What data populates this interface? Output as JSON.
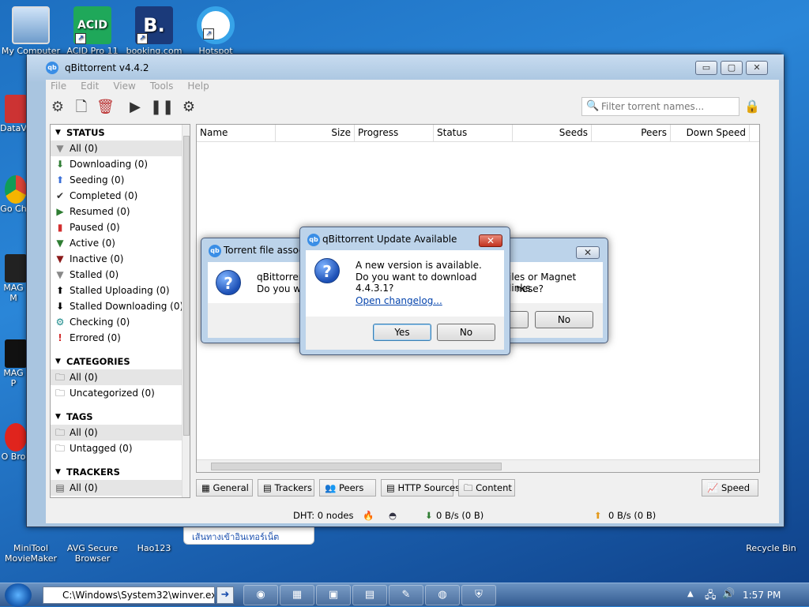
{
  "desktop": {
    "top_icons": [
      {
        "label": "My Computer"
      },
      {
        "label": "ACID Pro 11"
      },
      {
        "label": "booking.com"
      },
      {
        "label": "Hotspot"
      }
    ],
    "left_icons": [
      {
        "label": "DataV"
      },
      {
        "label": "Go Ch"
      },
      {
        "label": "MAG M"
      },
      {
        "label": "MAG P"
      },
      {
        "label": "O Bro"
      }
    ],
    "bottom_icons": [
      {
        "label": "MiniTool MovieMaker"
      },
      {
        "label": "AVG Secure Browser"
      },
      {
        "label": "Hao123"
      },
      {
        "label": "Recycle Bin"
      }
    ],
    "notification_text": "เส้นทางเข้าอินเทอร์เน็ต"
  },
  "window": {
    "title": "qBittorrent v4.4.2",
    "app_icon_text": "qb",
    "controls": {
      "minimize": "▭",
      "maximize": "▢",
      "close": "✕"
    },
    "menu": [
      "File",
      "Edit",
      "View",
      "Tools",
      "Help"
    ],
    "toolbar": {
      "add_link": "add-link-icon",
      "add_file": "add-file-icon",
      "delete": "delete-icon",
      "resume": "resume-icon",
      "pause": "pause-icon",
      "options": "options-icon"
    },
    "filter_placeholder": "Filter torrent names..."
  },
  "sidebar": {
    "status_header": "STATUS",
    "status": [
      {
        "label": "All (0)",
        "icon": "filter-icon",
        "color": "#888888"
      },
      {
        "label": "Downloading (0)",
        "icon": "download-arrow-icon",
        "color": "#2e7d32"
      },
      {
        "label": "Seeding (0)",
        "icon": "upload-arrow-icon",
        "color": "#3a6fd8"
      },
      {
        "label": "Completed (0)",
        "icon": "checkmark-icon",
        "color": "#333333"
      },
      {
        "label": "Resumed (0)",
        "icon": "play-icon",
        "color": "#2e7d32"
      },
      {
        "label": "Paused (0)",
        "icon": "pause-icon",
        "color": "#d32f2f"
      },
      {
        "label": "Active (0)",
        "icon": "filter-icon",
        "color": "#2e7d32"
      },
      {
        "label": "Inactive (0)",
        "icon": "filter-icon",
        "color": "#8b1a1a"
      },
      {
        "label": "Stalled (0)",
        "icon": "filter-icon",
        "color": "#888888"
      },
      {
        "label": "Stalled Uploading (0)",
        "icon": "upload-arrow-icon",
        "color": "#000000"
      },
      {
        "label": "Stalled Downloading (0)",
        "icon": "download-arrow-icon",
        "color": "#000000"
      },
      {
        "label": "Checking (0)",
        "icon": "gear-icon",
        "color": "#1a8a8a"
      },
      {
        "label": "Errored (0)",
        "icon": "exclamation-icon",
        "color": "#d32f2f"
      }
    ],
    "categories_header": "CATEGORIES",
    "categories": [
      "All (0)",
      "Uncategorized (0)"
    ],
    "tags_header": "TAGS",
    "tags": [
      "All (0)",
      "Untagged (0)"
    ],
    "trackers_header": "TRACKERS",
    "trackers": [
      "All (0)"
    ]
  },
  "torrent_list": {
    "columns": [
      "Name",
      "Size",
      "Progress",
      "Status",
      "Seeds",
      "Peers",
      "Down Speed"
    ]
  },
  "bottom_tabs": [
    "General",
    "Trackers",
    "Peers",
    "HTTP Sources",
    "Content",
    "Speed"
  ],
  "statusbar": {
    "dht": "DHT: 0 nodes",
    "download": "0 B/s (0 B)",
    "upload": "0 B/s (0 B)"
  },
  "dialog_assoc": {
    "title": "Torrent file associ",
    "line1_left": "qBittorren",
    "line1_right": "iles or Magnet links.",
    "line2_left": "Do you wa",
    "line2_right": "nese?",
    "no_label": "No"
  },
  "dialog_update": {
    "title": "qBittorrent Update Available",
    "line1": "A new version is available.",
    "line2": "Do you want to download 4.4.3.1?",
    "link": "Open changelog...",
    "yes_label": "Yes",
    "no_label": "No"
  },
  "taskbar": {
    "address": "C:\\Windows\\System32\\winver.ex",
    "time": "1:57 PM"
  }
}
